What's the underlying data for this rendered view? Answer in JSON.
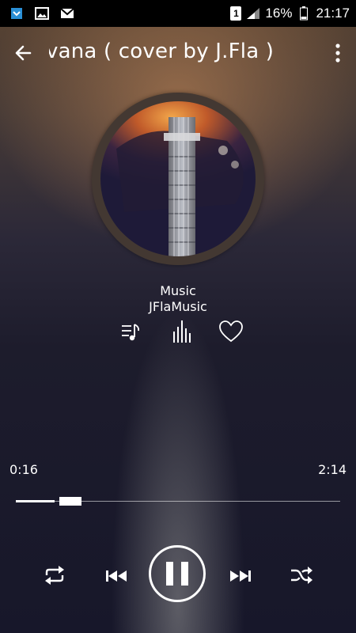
{
  "status_bar": {
    "icons": [
      "app-notification-icon",
      "gallery-icon",
      "mail-icon"
    ],
    "sim": "1",
    "battery": "16%",
    "time": "21:17"
  },
  "app_bar": {
    "title": "vana ( cover by J.Fla )"
  },
  "track": {
    "album": "Music",
    "artist": "JFlaMusic"
  },
  "progress": {
    "elapsed": "0:16",
    "total": "2:14",
    "fraction": 0.12
  },
  "colors": {
    "accent": "#ffffff",
    "ring": "#433832"
  },
  "controls": [
    "repeat-icon",
    "previous-icon",
    "pause-icon",
    "next-icon",
    "shuffle-icon"
  ]
}
